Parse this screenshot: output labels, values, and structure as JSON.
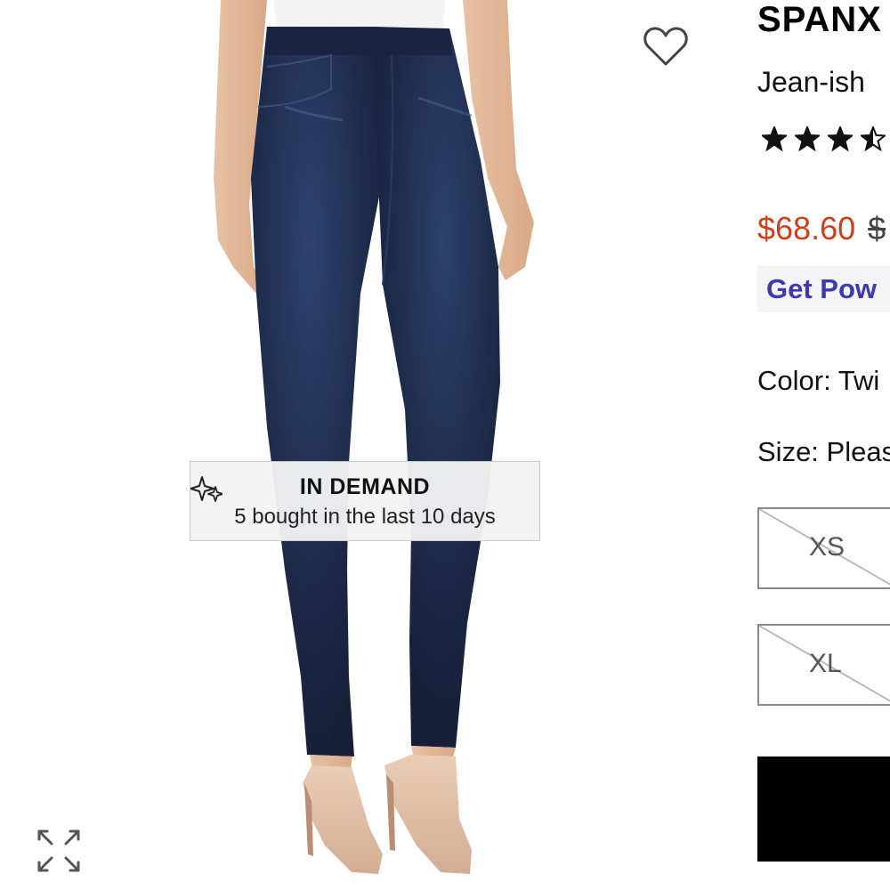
{
  "badge": {
    "title": "IN DEMAND",
    "subtitle": "5 bought in the last 10 days",
    "icon": "sparkle-icon"
  },
  "product": {
    "brand": "SPANX",
    "name": "Jean-ish",
    "rating": 3.5,
    "rating_max": 5,
    "sale_price": "$68.60",
    "original_price_visible": "$"
  },
  "promo": {
    "label": "Get Pow"
  },
  "color": {
    "label": "Color:",
    "value": "Twi"
  },
  "size": {
    "label": "Size:",
    "value": "Pleas",
    "options": [
      {
        "label": "XS",
        "available": false
      },
      {
        "label": "XL",
        "available": false
      }
    ]
  },
  "icons": {
    "wishlist": "heart-outline-icon",
    "expand": "expand-icon"
  },
  "colors": {
    "sale": "#cf4019",
    "promo": "#3d39b0",
    "denim": "#1d2a44"
  }
}
